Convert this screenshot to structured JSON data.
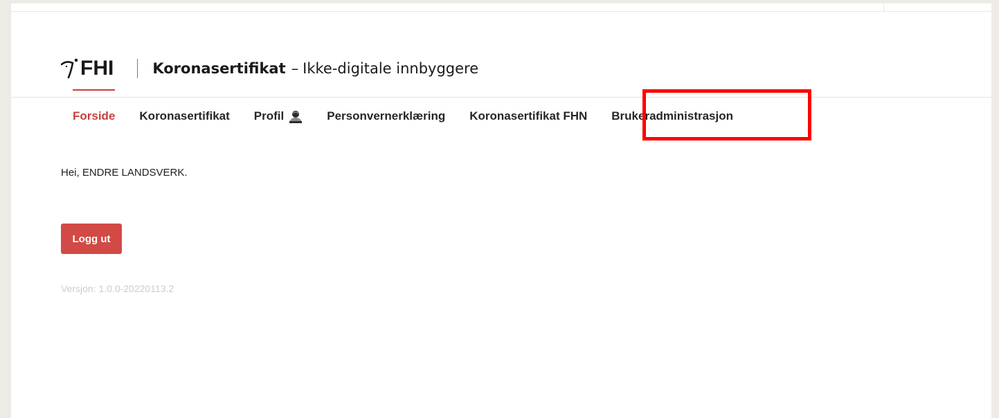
{
  "header": {
    "logo_text": "FHI",
    "title_strong": "Koronasertifikat",
    "title_dash": "–",
    "title_rest": "Ikke-digitale innbyggere",
    "accent_color": "#c8403c"
  },
  "nav": {
    "items": [
      {
        "label": "Forside",
        "active": true
      },
      {
        "label": "Koronasertifikat",
        "active": false
      },
      {
        "label": "Profil",
        "active": false,
        "icon": "person-icon"
      },
      {
        "label": "Personvernerklæring",
        "active": false
      },
      {
        "label": "Koronasertifikat FHN",
        "active": false
      },
      {
        "label": "Brukeradministrasjon",
        "active": false
      }
    ],
    "highlight_color": "#ff0000"
  },
  "main": {
    "greeting": "Hei, ENDRE LANDSVERK.",
    "logout_label": "Logg ut",
    "logout_color": "#d24a45",
    "version": "Versjon: 1.0.0-20220113.2"
  }
}
